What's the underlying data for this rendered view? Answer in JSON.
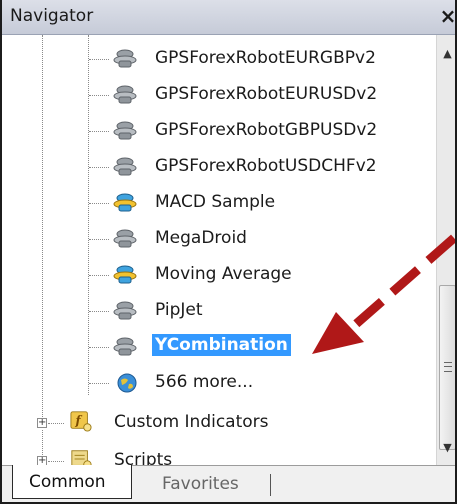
{
  "panel": {
    "title": "Navigator",
    "close": "×"
  },
  "tree": {
    "items": [
      {
        "label": "GPSForexRobotEURGBPv2",
        "icon": "expert-advisor-gray-icon",
        "selected": false
      },
      {
        "label": "GPSForexRobotEURUSDv2",
        "icon": "expert-advisor-gray-icon",
        "selected": false
      },
      {
        "label": "GPSForexRobotGBPUSDv2",
        "icon": "expert-advisor-gray-icon",
        "selected": false
      },
      {
        "label": "GPSForexRobotUSDCHFv2",
        "icon": "expert-advisor-gray-icon",
        "selected": false
      },
      {
        "label": "MACD Sample",
        "icon": "expert-advisor-blue-icon",
        "selected": false
      },
      {
        "label": "MegaDroid",
        "icon": "expert-advisor-gray-icon",
        "selected": false
      },
      {
        "label": "Moving Average",
        "icon": "expert-advisor-blue-icon",
        "selected": false
      },
      {
        "label": "PipJet",
        "icon": "expert-advisor-gray-icon",
        "selected": false
      },
      {
        "label": "YCombination",
        "icon": "expert-advisor-gray-icon",
        "selected": true
      },
      {
        "label": "566 more...",
        "icon": "globe-icon",
        "selected": false
      }
    ],
    "folders": [
      {
        "label": "Custom Indicators",
        "icon": "function-folder-icon"
      },
      {
        "label": "Scripts",
        "icon": "script-folder-icon"
      }
    ]
  },
  "tabs": [
    {
      "label": "Common",
      "active": true
    },
    {
      "label": "Favorites",
      "active": false
    }
  ],
  "colors": {
    "selection": "#3399ff",
    "arrow": "#b01818"
  }
}
